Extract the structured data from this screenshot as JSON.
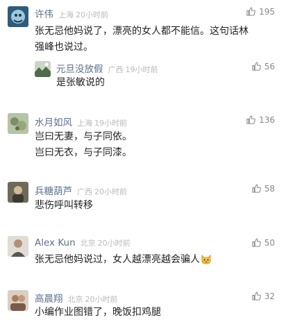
{
  "comments": [
    {
      "user": "许伟",
      "location": "上海",
      "time": "20小时前",
      "likes": "195",
      "lines": [
        "张无忌他妈说了，漂亮的女人都不能信。这句话林",
        "强峰也说过。"
      ],
      "reply": {
        "user": "元旦没放假",
        "location": "广西",
        "time": "19小时前",
        "likes": "56",
        "text": "是张敏说的"
      }
    },
    {
      "user": "水月如风",
      "location": "上海",
      "time": "19小时前",
      "likes": "136",
      "lines": [
        "岂曰无妻，与子同依。",
        "岂曰无衣，与子同漆。"
      ]
    },
    {
      "user": "兵糖葫芦",
      "location": "广西",
      "time": "20小时前",
      "likes": "58",
      "lines": [
        "悲伤呼叫转移"
      ]
    },
    {
      "user": "Alex Kun",
      "location": "北京",
      "time": "20小时前",
      "likes": "50",
      "lines": [
        "张无忌他妈说过，女人越漂亮越会骗人"
      ],
      "emoji": "cat-face-emoji"
    },
    {
      "user": "高晨翔",
      "location": "北京",
      "time": "20小时前",
      "likes": "32",
      "lines": [
        "小编作业图错了，晚饭扣鸡腿"
      ]
    }
  ],
  "colors": {
    "username": "#5a6f8c",
    "meta": "#b8b8b8",
    "text": "#222222",
    "like": "#888888"
  }
}
